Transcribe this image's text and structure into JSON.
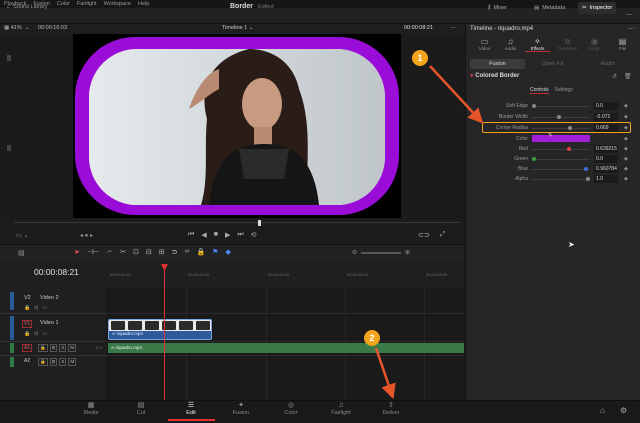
{
  "menubar": [
    "Playback",
    "Fusion",
    "Color",
    "Fairlight",
    "Workspace",
    "Help"
  ],
  "toolbar": {
    "library": "Sound Library",
    "title": "Border",
    "status": "Edited",
    "mixer": "Mixer",
    "metadata": "Metadata",
    "inspector": "Inspector"
  },
  "viewer": {
    "zoom": "41%",
    "timecode_left": "00:00:16:03",
    "timeline_name": "Timeline 1",
    "timecode_right": "00:00:08:21"
  },
  "inspector": {
    "title": "Timeline - riquadro.mp4",
    "tabs": [
      "Video",
      "Audio",
      "Effects",
      "Transition",
      "Image",
      "File"
    ],
    "fusion_tabs": [
      "Fusion",
      "Open FX",
      "Audio"
    ],
    "effect_name": "Colored Border",
    "subtabs": [
      "Controls",
      "Settings"
    ],
    "params": [
      {
        "label": "Soft Edge",
        "value": "0.0",
        "fraction": 0.0
      },
      {
        "label": "Border Width",
        "value": "-0.072",
        "fraction": 0.46
      },
      {
        "label": "Corner Radius",
        "value": "0.669",
        "fraction": 0.67
      },
      {
        "label": "Color",
        "value": "",
        "color": "#a21ed8"
      },
      {
        "label": "Red",
        "value": "0.639215",
        "fraction": 0.64
      },
      {
        "label": "Green",
        "value": "0.0",
        "fraction": 0.0
      },
      {
        "label": "Blue",
        "value": "0.960784",
        "fraction": 0.96
      },
      {
        "label": "Alpha",
        "value": "1.0",
        "fraction": 1.0
      }
    ]
  },
  "timeline": {
    "timecode": "00:00:08:21",
    "ruler": [
      "00:00:00:00",
      "00:00:12:00",
      "00:00:24:00",
      "00:00:36:00",
      "00:00:48:00"
    ],
    "tracks": [
      {
        "id": "V2",
        "name": "Video 2"
      },
      {
        "id": "V1",
        "name": "Video 1"
      },
      {
        "id": "A1",
        "name": ""
      },
      {
        "id": "A2",
        "name": ""
      }
    ],
    "video_clip": "riquadro.mp4",
    "audio_clip": "riquadro.mp4",
    "audio_level": "2.0"
  },
  "pages": [
    "Media",
    "Cut",
    "Edit",
    "Fusion",
    "Color",
    "Fairlight",
    "Deliver"
  ],
  "annotations": [
    "1",
    "2"
  ],
  "colors": {
    "accent": "#f2a51a",
    "playhead": "#e43232",
    "border": "#9a0cd8"
  }
}
